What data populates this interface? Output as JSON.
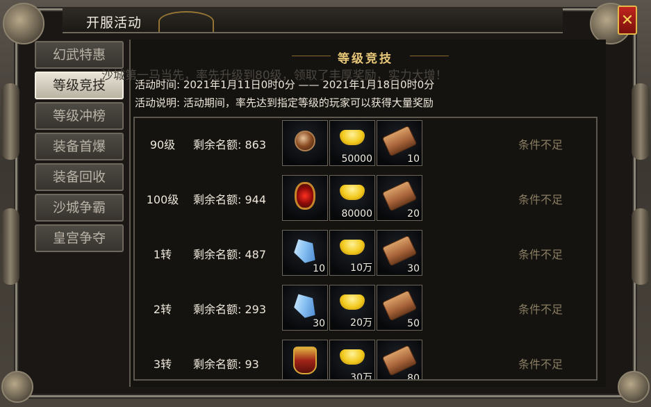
{
  "window": {
    "title": "开服活动",
    "close_label": "✕"
  },
  "sidebar": {
    "items": [
      {
        "label": "幻武特惠",
        "active": false
      },
      {
        "label": "等级竞技",
        "active": true
      },
      {
        "label": "等级冲榜",
        "active": false
      },
      {
        "label": "装备首爆",
        "active": false
      },
      {
        "label": "装备回收",
        "active": false
      },
      {
        "label": "沙城争霸",
        "active": false
      },
      {
        "label": "皇宫争夺",
        "active": false
      }
    ]
  },
  "header": {
    "title": "等级竞技",
    "ghost_text": "沙城第一马当先，率先升级到80级，领取了丰厚奖励，实力大增！",
    "time_line": "活动时间: 2021年1月11日0时0分   ——   2021年1月18日0时0分",
    "desc_line": "活动说明: 活动期间，率先达到指定等级的玩家可以获得大量奖励"
  },
  "rows": [
    {
      "level": "90级",
      "quota": "剩余名额: 863",
      "status": "条件不足",
      "items": [
        {
          "icon": "orb-icon",
          "count": ""
        },
        {
          "icon": "gold-ingot-icon",
          "count": "50000"
        },
        {
          "icon": "scroll-icon",
          "count": "10"
        }
      ]
    },
    {
      "level": "100级",
      "quota": "剩余名额: 944",
      "status": "条件不足",
      "items": [
        {
          "icon": "amulet-icon",
          "count": ""
        },
        {
          "icon": "gold-ingot-icon",
          "count": "80000"
        },
        {
          "icon": "scroll-icon",
          "count": "20"
        }
      ]
    },
    {
      "level": "1转",
      "quota": "剩余名额: 487",
      "status": "条件不足",
      "items": [
        {
          "icon": "crystal-icon",
          "count": "10"
        },
        {
          "icon": "gold-ingot-icon",
          "count": "10万"
        },
        {
          "icon": "scroll-icon",
          "count": "30"
        }
      ]
    },
    {
      "level": "2转",
      "quota": "剩余名额: 293",
      "status": "条件不足",
      "items": [
        {
          "icon": "crystal-icon",
          "count": "30"
        },
        {
          "icon": "gold-ingot-icon",
          "count": "20万"
        },
        {
          "icon": "scroll-icon",
          "count": "50"
        }
      ]
    },
    {
      "level": "3转",
      "quota": "剩余名额: 93",
      "status": "条件不足",
      "items": [
        {
          "icon": "armor-icon",
          "count": ""
        },
        {
          "icon": "gold-ingot-icon",
          "count": "30万"
        },
        {
          "icon": "scroll-icon",
          "count": "80"
        }
      ]
    }
  ]
}
